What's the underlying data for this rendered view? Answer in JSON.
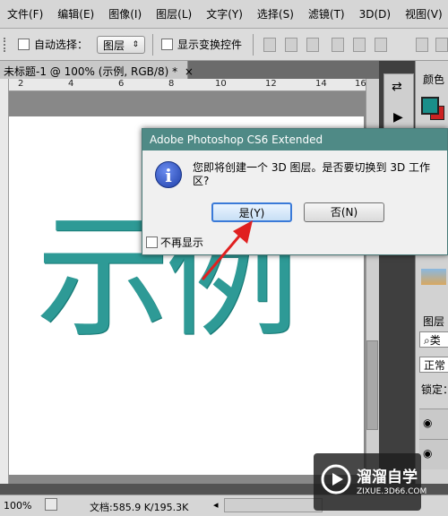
{
  "menubar": {
    "items": [
      "文件(F)",
      "编辑(E)",
      "图像(I)",
      "图层(L)",
      "文字(Y)",
      "选择(S)",
      "滤镜(T)",
      "3D(D)",
      "视图(V)"
    ]
  },
  "options": {
    "auto_select_label": "自动选择：",
    "layer_select_value": "图层",
    "show_transform_label": "显示变换控件"
  },
  "document": {
    "tab_title": "未标题-1 @ 100% (示例, RGB/8) *",
    "ruler_marks": [
      "2",
      "4",
      "6",
      "8",
      "10",
      "12",
      "14",
      "16"
    ],
    "canvas_text": "示例"
  },
  "dialog": {
    "title": "Adobe Photoshop CS6 Extended",
    "message": "您即将创建一个 3D 图层。是否要切换到 3D 工作区?",
    "yes_label": "是(Y)",
    "no_label": "否(N)",
    "dont_show_label": "不再显示"
  },
  "panels": {
    "color_tab": "颜色",
    "layers_tab": "图层",
    "kind_filter": "类",
    "blend_mode": "正常",
    "lock_label": "锁定："
  },
  "status": {
    "zoom": "100%",
    "doc_size": "文档:585.9 K/195.3K"
  },
  "watermark": {
    "brand": "溜溜自学",
    "url": "ZIXUE.3D66.COM"
  },
  "colors": {
    "teal_text": "#2e9a96",
    "dialog_title_bg": "#4f8a86",
    "arrow": "#e02020"
  }
}
